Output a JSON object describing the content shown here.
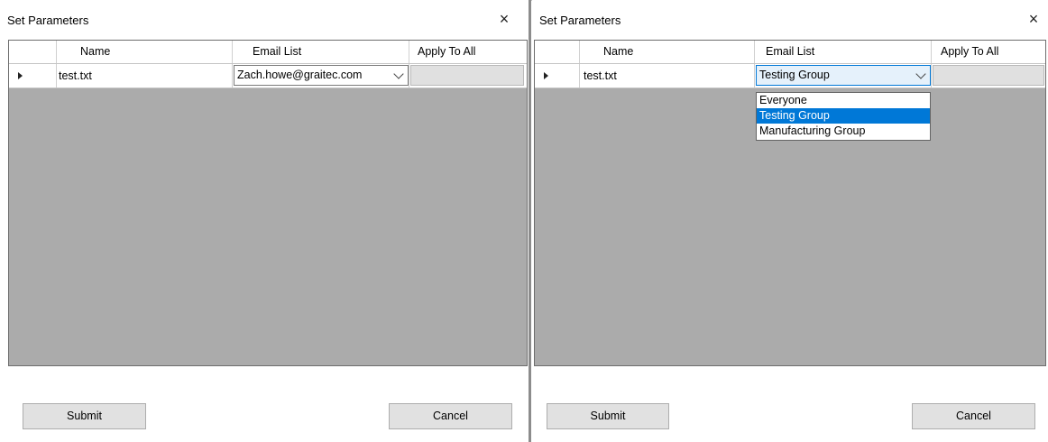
{
  "left_dialog": {
    "title": "Set Parameters",
    "close_glyph": "×",
    "columns": [
      "Name",
      "Email List",
      "Apply To All"
    ],
    "row": {
      "name": "test.txt",
      "email_list": "Zach.howe@graitec.com"
    },
    "buttons": {
      "submit": "Submit",
      "cancel": "Cancel"
    }
  },
  "right_dialog": {
    "title": "Set Parameters",
    "close_glyph": "×",
    "columns": [
      "Name",
      "Email List",
      "Apply To All"
    ],
    "row": {
      "name": "test.txt",
      "email_list": "Testing Group"
    },
    "dropdown_options": [
      "Everyone",
      "Testing Group",
      "Manufacturing Group"
    ],
    "selected_option": "Testing Group",
    "buttons": {
      "submit": "Submit",
      "cancel": "Cancel"
    }
  },
  "colors": {
    "grid_background": "#ababab",
    "selection": "#0078d7",
    "active_combo": "#e5f1fb",
    "button_face": "#e1e1e1"
  },
  "icons": [
    "close-icon",
    "row-indicator-icon",
    "chevron-down-icon"
  ]
}
